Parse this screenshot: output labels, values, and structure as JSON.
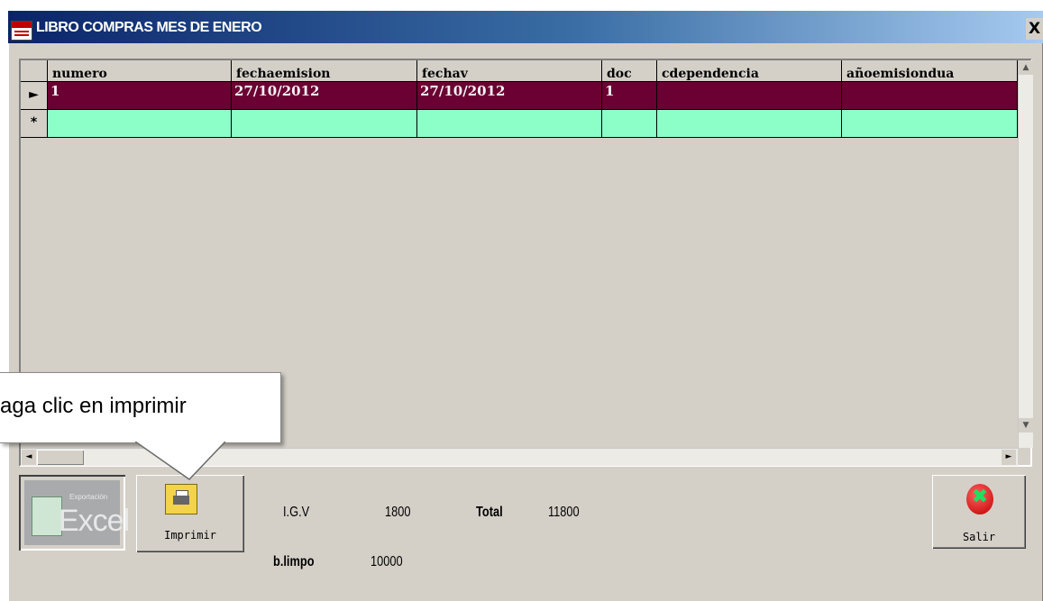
{
  "window": {
    "title": "LIBRO COMPRAS MES DE ENERO",
    "close_glyph": "X",
    "icon": "app-icon"
  },
  "grid": {
    "columns": [
      "numero",
      "fechaemision",
      "fechav",
      "doc",
      "cdependencia",
      "añoemisiondua"
    ],
    "rows": [
      {
        "indicator": "►",
        "cells": [
          "1",
          "27/10/2012",
          "27/10/2012",
          "1",
          "",
          ""
        ]
      }
    ],
    "new_row_indicator": "*",
    "colors": {
      "selected_row": "#6b0032",
      "new_row": "#8cffc8"
    }
  },
  "buttons": {
    "excel": {
      "small_text": "Exportación",
      "big_text": "Excel",
      "icon": "excel-icon"
    },
    "print": {
      "label": "Imprimir",
      "icon": "printer-icon"
    },
    "exit": {
      "label": "Salir",
      "icon": "exit-icon"
    }
  },
  "totals": {
    "igv_label": "I.G.V",
    "igv_value": "1800",
    "total_label": "Total",
    "total_value": "11800",
    "bimpo_label": "b.limpo",
    "bimpo_value": "10000"
  },
  "callout": {
    "text": "aga clic en imprimir"
  }
}
